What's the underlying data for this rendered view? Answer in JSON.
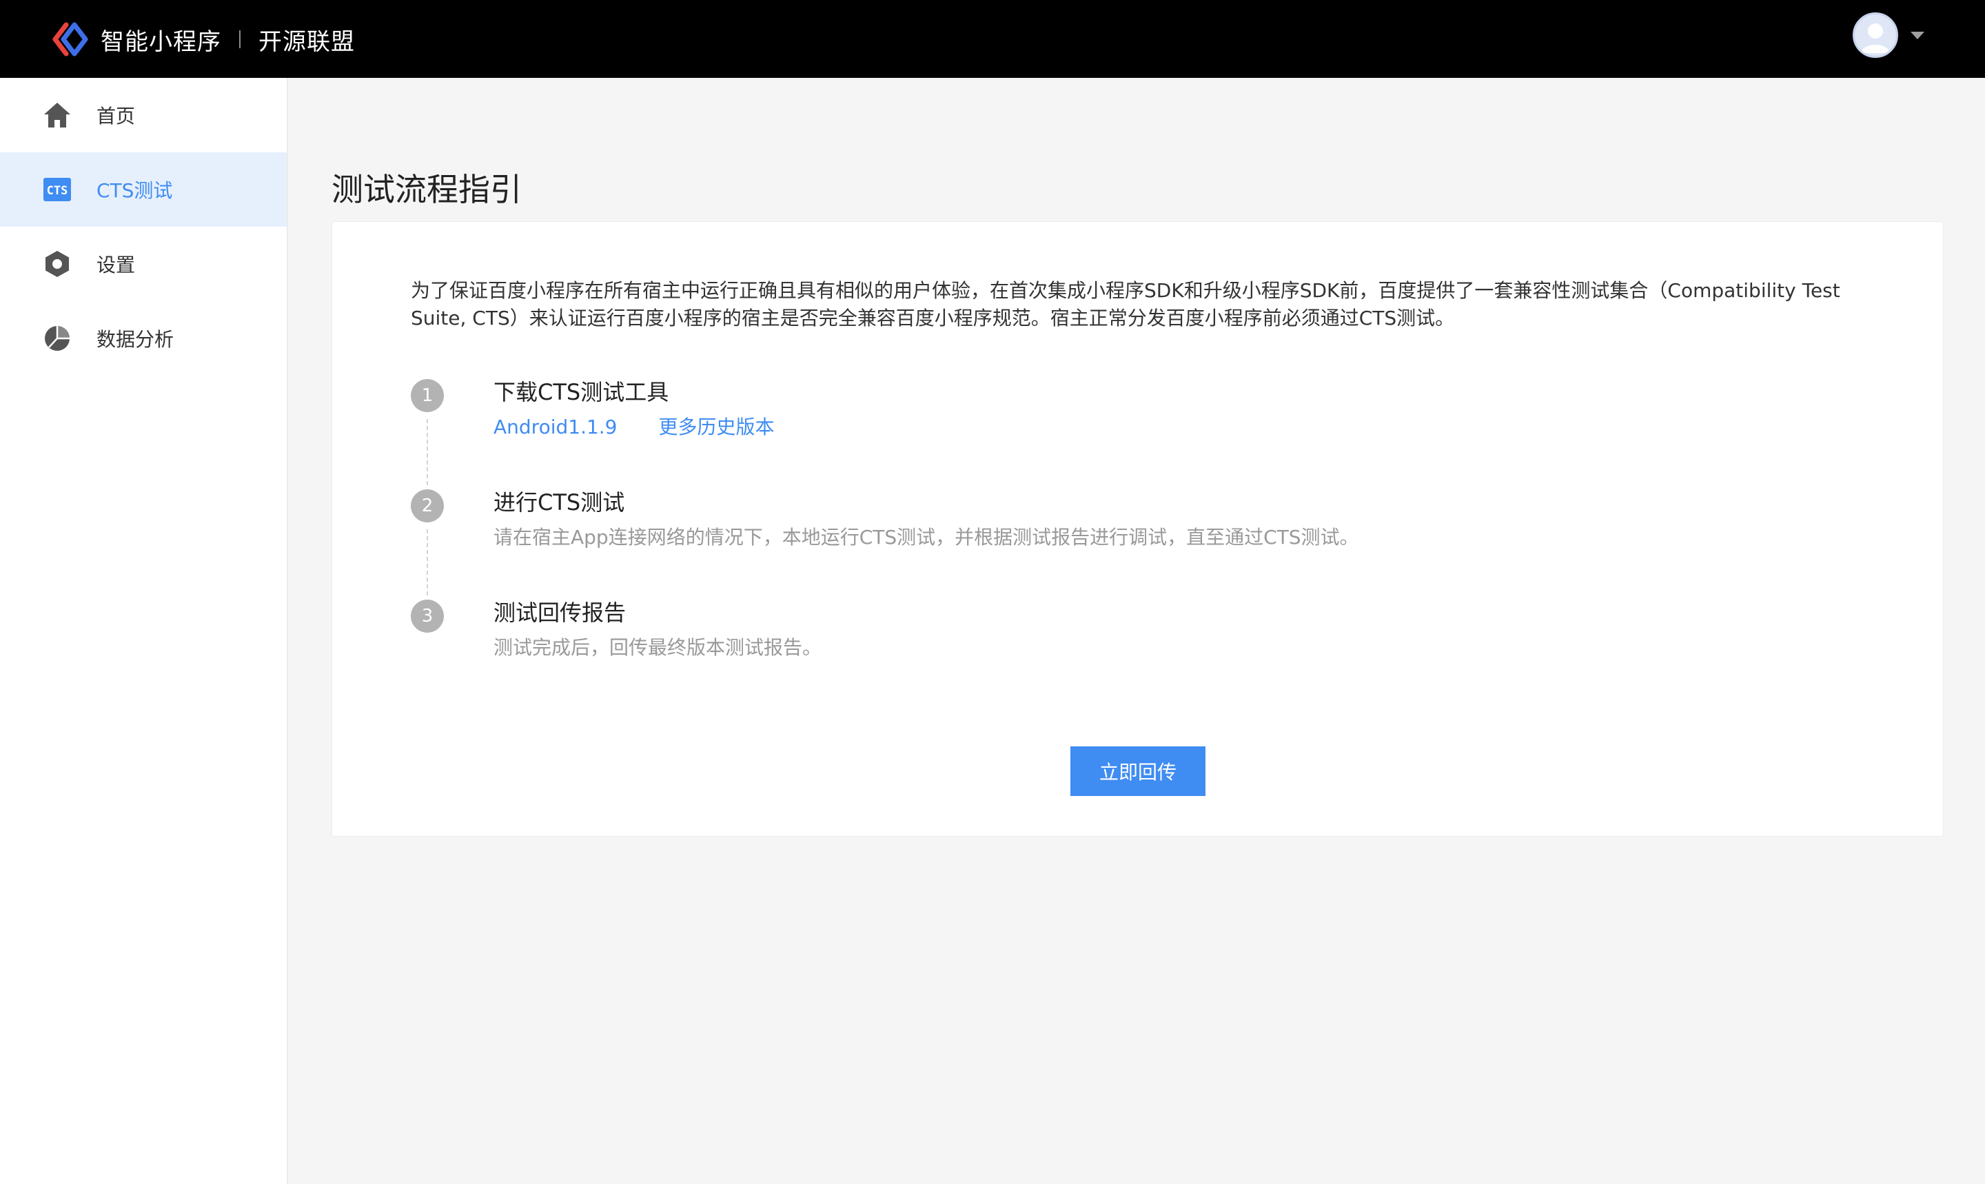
{
  "header": {
    "app_name": "智能小程序",
    "sub_title": "开源联盟",
    "logo_icon": "swan-logo-icon",
    "avatar_icon": "user-avatar-icon",
    "colors": {
      "background": "#000000",
      "logo_blue": "#3f6ee8",
      "logo_red": "#e8423c"
    }
  },
  "sidebar": {
    "items": [
      {
        "label": "首页",
        "icon": "home-icon",
        "active": false
      },
      {
        "label": "CTS测试",
        "icon": "cts-icon",
        "active": true
      },
      {
        "label": "设置",
        "icon": "settings-icon",
        "active": false
      },
      {
        "label": "数据分析",
        "icon": "pie-chart-icon",
        "active": false
      }
    ],
    "active_color": "#3f8cf2"
  },
  "main": {
    "title": "测试流程指引",
    "intro": "为了保证百度小程序在所有宿主中运行正确且具有相似的用户体验，在首次集成小程序SDK和升级小程序SDK前，百度提供了一套兼容性测试集合（Compatibility Test Suite, CTS）来认证运行百度小程序的宿主是否完全兼容百度小程序规范。宿主正常分发百度小程序前必须通过CTS测试。",
    "steps": [
      {
        "number": "1",
        "title": "下载CTS测试工具",
        "links": [
          "Android1.1.9",
          "更多历史版本"
        ]
      },
      {
        "number": "2",
        "title": "进行CTS测试",
        "description": "请在宿主App连接网络的情况下，本地运行CTS测试，并根据测试报告进行调试，直至通过CTS测试。"
      },
      {
        "number": "3",
        "title": "测试回传报告",
        "description": "测试完成后，回传最终版本测试报告。"
      }
    ],
    "submit_label": "立即回传",
    "primary_color": "#3f8cf2"
  }
}
